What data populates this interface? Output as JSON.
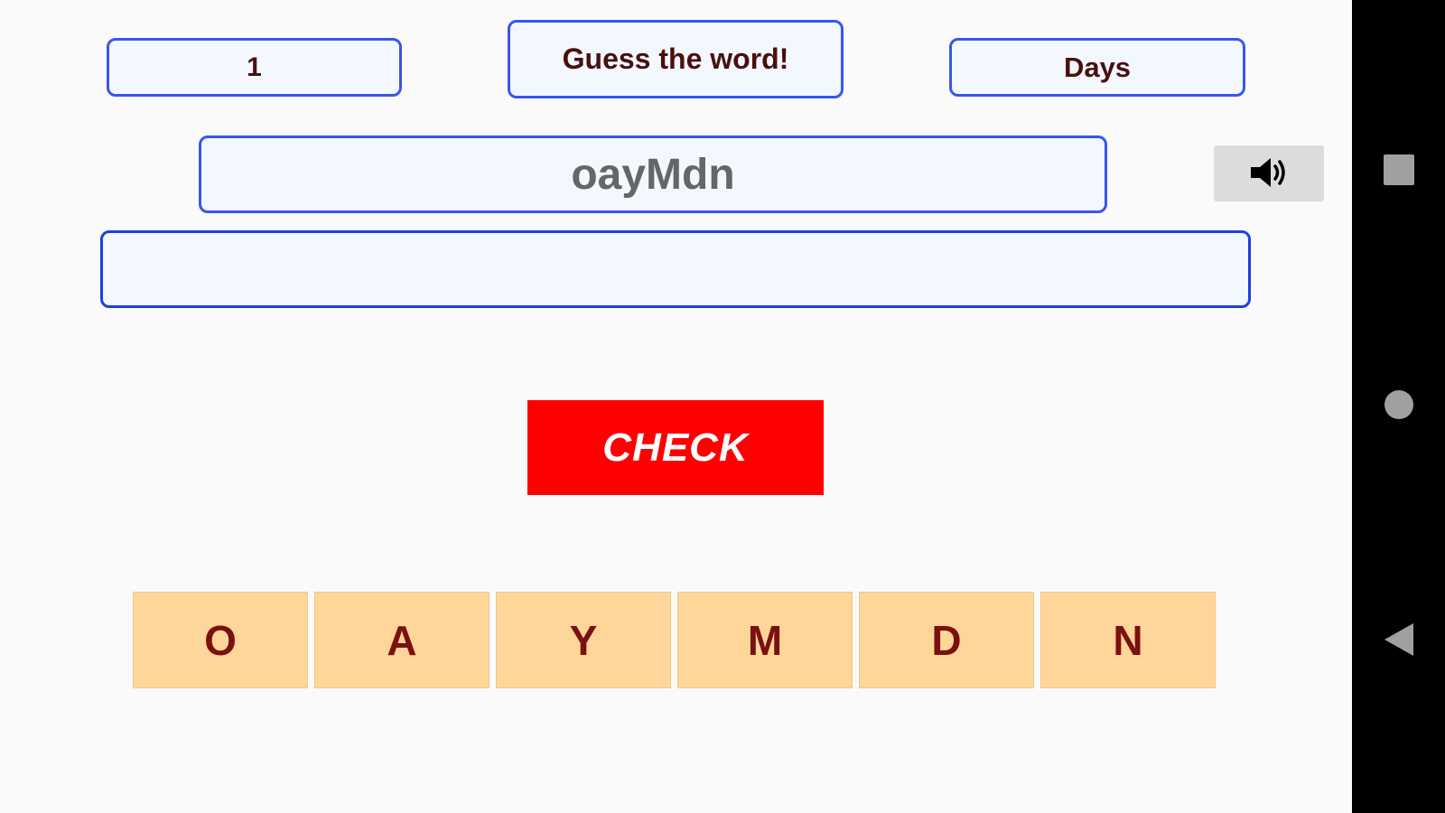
{
  "game": {
    "level": "1",
    "title": "Guess the word!",
    "category": "Days",
    "scrambled_word": "oayMdn",
    "answer_value": "",
    "check_label": "CHECK",
    "letters": [
      "O",
      "A",
      "Y",
      "M",
      "D",
      "N"
    ]
  },
  "icons": {
    "sound": "speaker-icon",
    "recents": "square-icon",
    "home": "circle-icon",
    "back": "triangle-back-icon"
  },
  "colors": {
    "accent_border": "#3a55ee",
    "check_button": "#ff0000",
    "tile_bg": "#ffd699",
    "tile_text": "#7a1010"
  }
}
